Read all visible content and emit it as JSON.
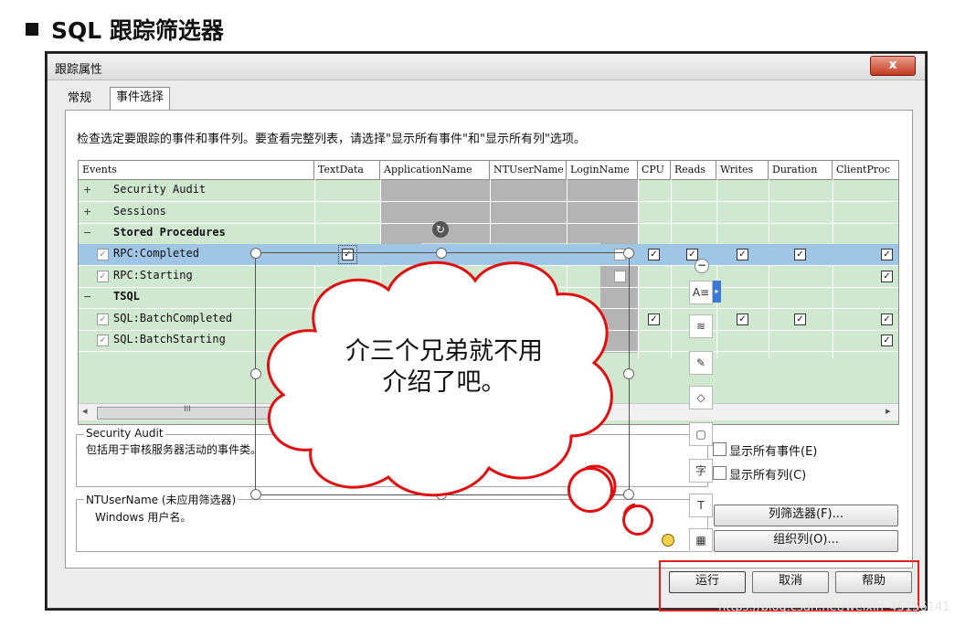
{
  "heading": "SQL 跟踪筛选器",
  "window": {
    "title": "跟踪属性",
    "close_label": "x",
    "tabs": [
      "常规",
      "事件选择"
    ]
  },
  "description": "检查选定要跟踪的事件和事件列。要查看完整列表，请选择\"显示所有事件\"和\"显示所有列\"选项。",
  "grid": {
    "columns": [
      "Events",
      "TextData",
      "ApplicationName",
      "NTUserName",
      "LoginName",
      "CPU",
      "Reads",
      "Writes",
      "Duration",
      "ClientProc"
    ],
    "rows": [
      {
        "label": "Security Audit",
        "type": "category",
        "expander": "+"
      },
      {
        "label": "Sessions",
        "type": "category",
        "expander": "+"
      },
      {
        "label": "Stored Procedures",
        "type": "category-open",
        "expander": "−"
      },
      {
        "label": "RPC:Completed",
        "type": "event",
        "selected": true
      },
      {
        "label": "RPC:Starting",
        "type": "event"
      },
      {
        "label": "TSQL",
        "type": "category-open",
        "expander": "−"
      },
      {
        "label": "SQL:BatchCompleted",
        "type": "event"
      },
      {
        "label": "SQL:BatchStarting",
        "type": "event"
      }
    ],
    "scroll_grip": "III"
  },
  "event_group": {
    "title": "Security Audit",
    "text": "包括用于审核服务器活动的事件类。"
  },
  "column_group": {
    "title": "NTUserName (未应用筛选器)",
    "text": "Windows 用户名。"
  },
  "options": {
    "show_all_events": "显示所有事件(E)",
    "show_all_columns": "显示所有列(C)"
  },
  "buttons": {
    "column_filter": "列筛选器(F)...",
    "organize_columns": "组织列(O)...",
    "run": "运行",
    "cancel": "取消",
    "help": "帮助"
  },
  "callout": {
    "line1": "介三个兄弟就不用",
    "line2": "介绍了吧。"
  },
  "toolbar_icons": [
    "text-format-icon",
    "layers-icon",
    "pen-icon",
    "fill-icon",
    "border-icon",
    "font-icon",
    "text-box-icon",
    "arrange-icon"
  ],
  "watermark": "https://blog.csdn.net/weixin_45156141",
  "colors": {
    "grid_green": "#cfe8cf",
    "selected_row": "#9fc6e4",
    "disabled_col": "#b4b4b4",
    "highlight_red": "#e02020"
  }
}
